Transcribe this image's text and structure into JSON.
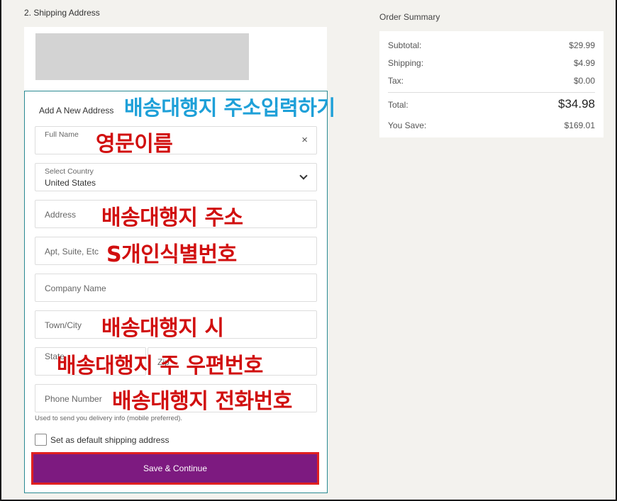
{
  "shipping": {
    "section_title": "2. Shipping Address",
    "form_heading": "Add A New Address",
    "fields": {
      "full_name": "Full Name",
      "country_label": "Select Country",
      "country_value": "United States",
      "address": "Address",
      "apt": "Apt, Suite, Etc",
      "company": "Company Name",
      "city": "Town/City",
      "state": "State",
      "zip": "Zip",
      "phone": "Phone Number"
    },
    "helper_text": "Used to send you delivery info (mobile preferred).",
    "default_checkbox_label": "Set as default shipping address",
    "save_button": "Save & Continue",
    "clear_icon": "×"
  },
  "annotations": {
    "title": "배송대행지 주소입력하기",
    "full_name": "영문이름",
    "address": "배송대행지 주소",
    "apt": "S개인식별번호",
    "city": "배송대행지 시",
    "state_zip": "배송대행지 주  우편번호",
    "phone": "배송대행지 전화번호"
  },
  "order_summary": {
    "title": "Order Summary",
    "rows": [
      {
        "label": "Subtotal:",
        "value": "$29.99"
      },
      {
        "label": "Shipping:",
        "value": "$4.99"
      },
      {
        "label": "Tax:",
        "value": "$0.00"
      }
    ],
    "total": {
      "label": "Total:",
      "value": "$34.98"
    },
    "savings": {
      "label": "You Save:",
      "value": "$169.01"
    }
  },
  "colors": {
    "accent": "#7d1a80",
    "card_border": "#2a8a92",
    "annotation_red": "#d10f0f",
    "annotation_blue": "#1ea0d8"
  }
}
